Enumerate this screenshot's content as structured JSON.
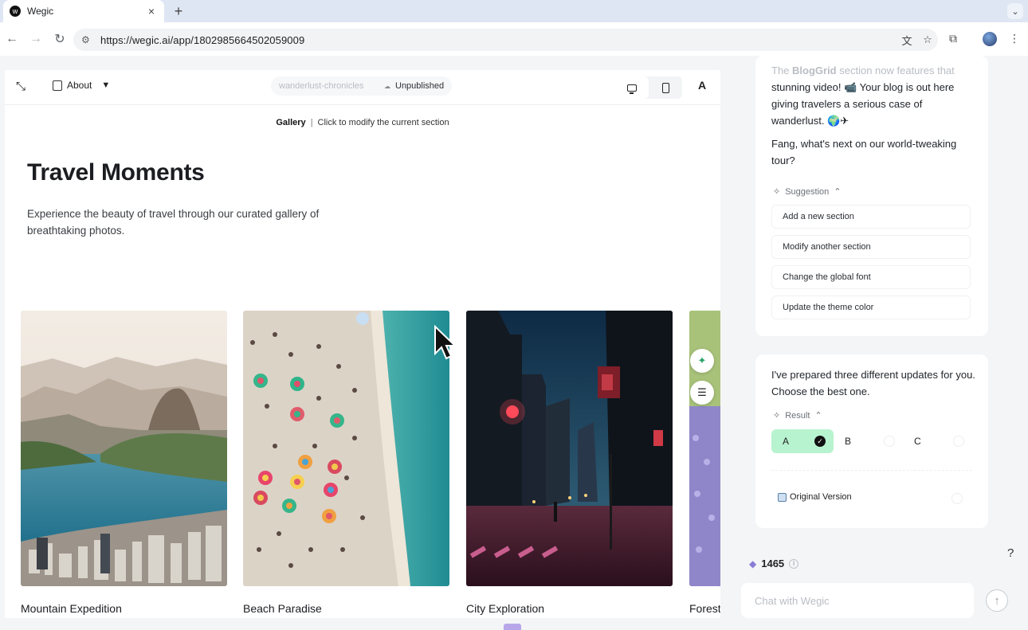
{
  "browser": {
    "tab_title": "Wegic",
    "tab_close": "×",
    "new_tab": "+",
    "url": "https://wegic.ai/app/1802985664502059009"
  },
  "editor": {
    "about_label": "About",
    "site_name": "wanderlust-chronicles",
    "publish_status": "Unpublished",
    "section_name": "Gallery",
    "section_separator": "|",
    "section_hint": "Click to modify the current section",
    "page_title": "Travel Moments",
    "page_description": "Experience the beauty of travel through our curated gallery of breathtaking photos.",
    "cards": [
      {
        "caption": "Mountain Expedition",
        "image": "mountain-bay-photo"
      },
      {
        "caption": "Beach Paradise",
        "image": "aerial-beach-photo"
      },
      {
        "caption": "City Exploration",
        "image": "night-city-street-photo"
      },
      {
        "caption": "Forest",
        "image": "forest-flowers-photo"
      }
    ]
  },
  "chat": {
    "msg1_line1_a": "The ",
    "msg1_line1_b": "BlogGrid",
    "msg1_line1_c": " section now features that",
    "msg1_line2": "stunning video! 📹  Your blog is out here giving travelers a serious case of wanderlust. 🌍✈",
    "msg1_question": "Fang, what's next on our world-tweaking tour?",
    "suggestion_label": "Suggestion",
    "suggestions": [
      "Add a new section",
      "Modify another section",
      "Change the global font",
      "Update the theme color"
    ],
    "msg2": "I've prepared three different updates for you. Choose the best one.",
    "result_label": "Result",
    "results": [
      "A",
      "B",
      "C"
    ],
    "selected_result": "A",
    "original_version": "Original Version",
    "credits": "1465",
    "help": "?",
    "input_placeholder": "Chat with Wegic"
  },
  "colors": {
    "selected_result_bg": "#b8f3cf",
    "panel_bg": "#f4f5f7",
    "accent_green": "#2aa36b"
  }
}
